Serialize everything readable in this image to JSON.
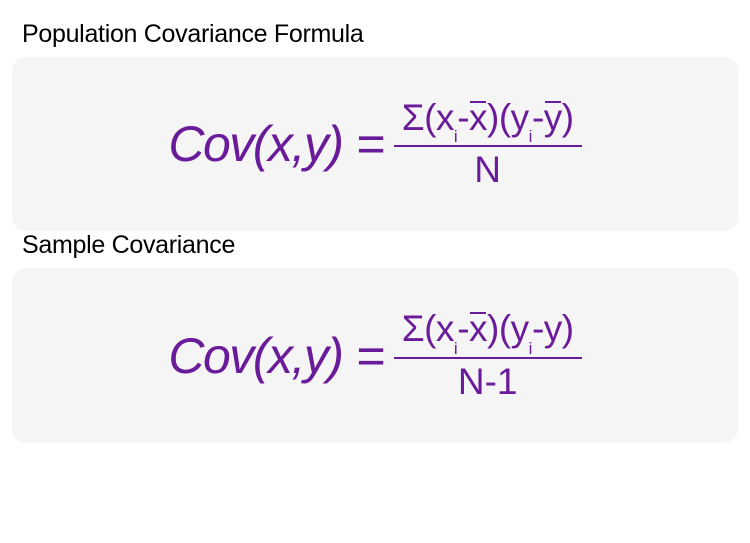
{
  "population": {
    "title": "Population Covariance Formula",
    "lhs": "Cov(x,y)",
    "equals": "=",
    "numerator_sigma": "Σ",
    "num_open1": "(",
    "num_x": "x",
    "num_i1": "i",
    "num_minus1": "-",
    "num_xbar": "x",
    "num_close1": ")",
    "num_open2": "(",
    "num_y": "y",
    "num_i2": "i",
    "num_minus2": "-",
    "num_ybar": "y",
    "num_close2": ")",
    "denominator": "N"
  },
  "sample": {
    "title": "Sample Covariance",
    "lhs": "Cov(x,y)",
    "equals": "=",
    "numerator_sigma": "Σ",
    "num_open1": "(",
    "num_x": "x",
    "num_i1": "i",
    "num_minus1": "-",
    "num_xbar": "x",
    "num_close1": ")",
    "num_open2": "(",
    "num_y": "y",
    "num_i2": "i",
    "num_minus2": "-",
    "num_ybar_plain": "y",
    "num_close2": ")",
    "denominator": "N-1"
  }
}
